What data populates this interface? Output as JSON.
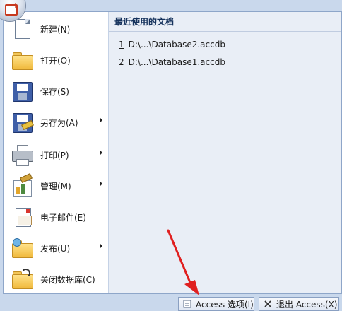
{
  "left_menu": [
    {
      "label": "新建(N)",
      "icon": "new-document-icon",
      "submenu": false
    },
    {
      "label": "打开(O)",
      "icon": "open-folder-icon",
      "submenu": false
    },
    {
      "label": "保存(S)",
      "icon": "save-icon",
      "submenu": false
    },
    {
      "label": "另存为(A)",
      "icon": "save-as-icon",
      "submenu": true
    },
    {
      "label": "打印(P)",
      "icon": "printer-icon",
      "submenu": true
    },
    {
      "label": "管理(M)",
      "icon": "manage-icon",
      "submenu": true
    },
    {
      "label": "电子邮件(E)",
      "icon": "email-icon",
      "submenu": false
    },
    {
      "label": "发布(U)",
      "icon": "publish-icon",
      "submenu": true
    },
    {
      "label": "关闭数据库(C)",
      "icon": "close-database-icon",
      "submenu": false
    }
  ],
  "recent_docs": {
    "title": "最近使用的文档",
    "items": [
      {
        "num": "1",
        "path": "D:\\...\\Database2.accdb"
      },
      {
        "num": "2",
        "path": "D:\\...\\Database1.accdb"
      }
    ]
  },
  "footer": {
    "options_label": "Access 选项(I)",
    "exit_label": "退出 Access(X)"
  },
  "colors": {
    "annotation_arrow": "#e02020"
  }
}
